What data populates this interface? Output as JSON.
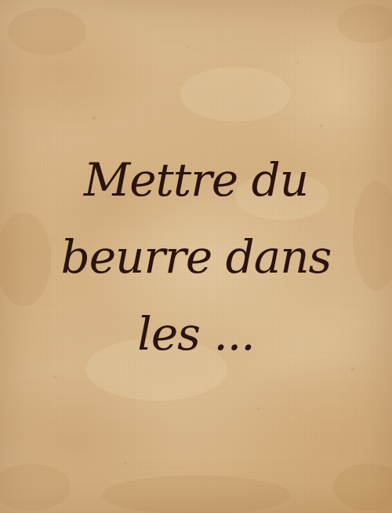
{
  "card": {
    "background_color": "#d7b98c",
    "text_color": "#2b130f",
    "lines": [
      "Mettre du",
      "beurre dans",
      "les ..."
    ]
  }
}
